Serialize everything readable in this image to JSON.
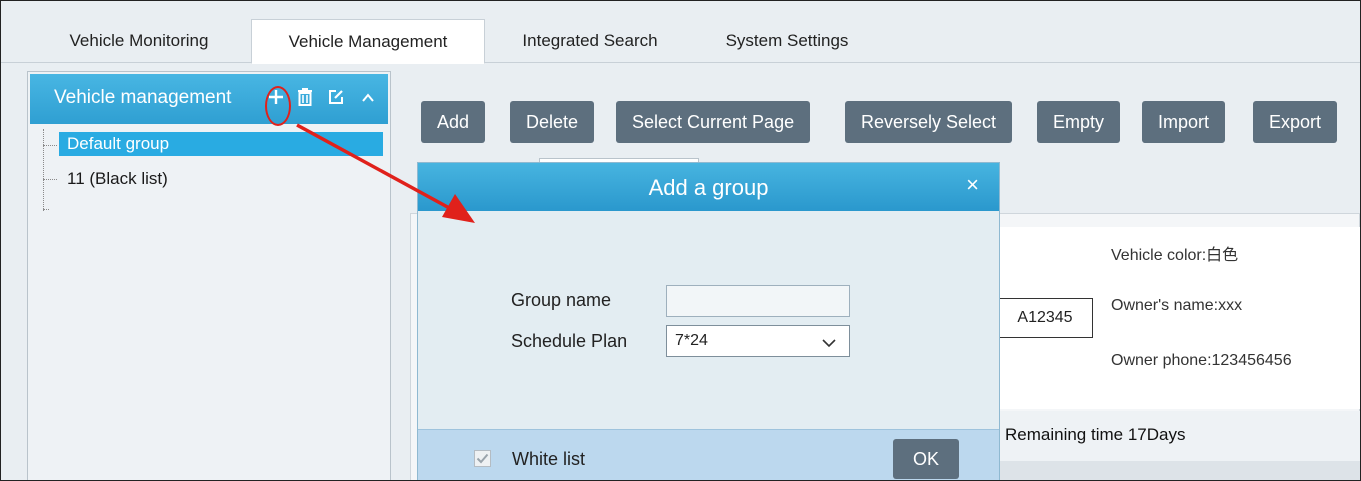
{
  "tabs": [
    {
      "label": "Vehicle Monitoring"
    },
    {
      "label": "Vehicle Management"
    },
    {
      "label": "Integrated Search"
    },
    {
      "label": "System Settings"
    }
  ],
  "left_panel": {
    "title": "Vehicle management",
    "icons": [
      "add-icon",
      "delete-icon",
      "edit-icon",
      "collapse-icon"
    ],
    "tree": [
      {
        "label": "Default group",
        "selected": true
      },
      {
        "label": "11 (Black list)",
        "selected": false
      }
    ]
  },
  "toolbar": {
    "buttons": [
      "Add",
      "Delete",
      "Select Current Page",
      "Reversely Select",
      "Empty",
      "Import",
      "Export"
    ]
  },
  "vehicle_card": {
    "plate": "A12345",
    "color_line": "Vehicle color:白色",
    "owner_line": "Owner's name:xxx",
    "phone_line": "Owner phone:123456456",
    "remaining": "Remaining time 17Days"
  },
  "dialog": {
    "title": "Add a group",
    "close_glyph": "×",
    "group_name_label": "Group name",
    "group_name_value": "",
    "schedule_label": "Schedule Plan",
    "schedule_value": "7*24",
    "white_list_label": "White list",
    "white_list_checked": true,
    "ok_label": "OK"
  },
  "colors": {
    "header_blue": "#2f9fd2",
    "button_gray": "#5d6f7e",
    "selection_blue": "#29abe2",
    "annotation_red": "#e0211b"
  }
}
